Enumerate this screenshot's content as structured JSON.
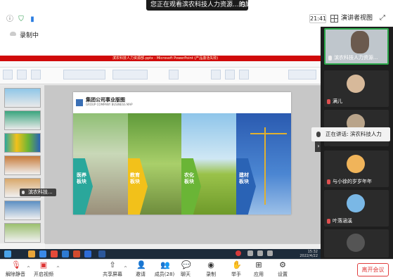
{
  "banner": {
    "text": "您正在观看滨农科技人力资源...的屏幕",
    "close": "⊟"
  },
  "topbar": {
    "time": "21:41",
    "view_label": "演讲者视图"
  },
  "recording": {
    "label": "录制中"
  },
  "powerpoint": {
    "title": "滨农科技人力资源部.pptx - Microsoft PowerPoint (产品激活失败)"
  },
  "slide": {
    "title": "集团公司事业版图",
    "subtitle": "GROUP COMPANY BUSINESS MAP",
    "panels": [
      {
        "label": "医养\n板块",
        "color": "#2aa79b"
      },
      {
        "label": "教育\n板块",
        "color": "#f2c11a"
      },
      {
        "label": "农化\n板块",
        "color": "#6ab536"
      },
      {
        "label": "建材\n板块",
        "color": "#2a63b5"
      }
    ]
  },
  "taskbar": {
    "time": "15:32",
    "date": "2022/4/22"
  },
  "shared_screen_speaker": "滨农科技...",
  "speaking_tip": "正在讲话: 滨农科技人力资...",
  "participants": [
    {
      "name": "滨农科技人力资源...",
      "muted": false,
      "active": true
    },
    {
      "name": "满儿",
      "muted": true,
      "active": false
    },
    {
      "name": "",
      "muted": true,
      "active": false
    },
    {
      "name": "与小徐的岁岁年年",
      "muted": true,
      "active": false
    },
    {
      "name": "叶落涵溪",
      "muted": true,
      "active": false
    },
    {
      "name": "",
      "muted": true,
      "active": false
    }
  ],
  "toolbar": {
    "mute": "解除静音",
    "video": "开启视频",
    "share": "共享屏幕",
    "invite": "邀请",
    "members": "成员(28)",
    "chat": "聊天",
    "record": "录制",
    "raise_hand": "举手",
    "apps": "应用",
    "settings": "设置",
    "leave": "离开会议"
  },
  "colors": {
    "accent_green": "#2ba84a",
    "leave_red": "#e03e3e",
    "ppt_title_red": "#d00a0a"
  }
}
